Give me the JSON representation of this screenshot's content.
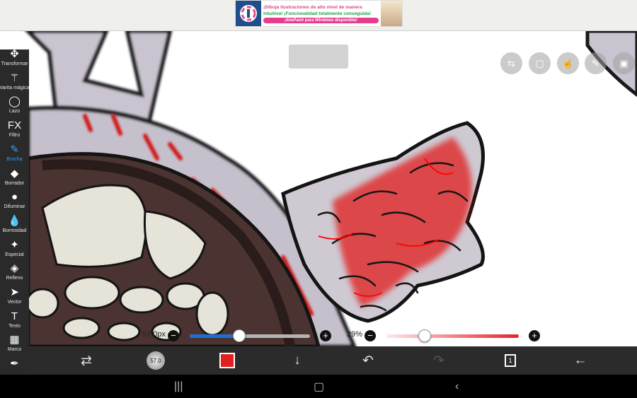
{
  "ad": {
    "line1": "¡Dibuja ilustraciones de alto nivel de manera",
    "line2": "intuitiva! ¡Funcionalidad totalmente conseguida!",
    "cta": "¡ibisPaint para Windows disponible!"
  },
  "toolbar": {
    "items": [
      {
        "label": "Transformar",
        "icon": "move-icon",
        "glyph": "✥"
      },
      {
        "label": "Varita mágica",
        "icon": "magic-wand-icon",
        "glyph": "⚚"
      },
      {
        "label": "Lazo",
        "icon": "lasso-icon",
        "glyph": "◯"
      },
      {
        "label": "Filtro",
        "icon": "fx-icon",
        "glyph": "FX"
      },
      {
        "label": "Brocha",
        "icon": "brush-icon",
        "glyph": "✎"
      },
      {
        "label": "Borrador",
        "icon": "eraser-icon",
        "glyph": "◆"
      },
      {
        "label": "Difuminar",
        "icon": "blur-icon",
        "glyph": "●"
      },
      {
        "label": "Borrosidad",
        "icon": "drop-icon",
        "glyph": "💧"
      },
      {
        "label": "Especial",
        "icon": "sparkle-icon",
        "glyph": "✦"
      },
      {
        "label": "Relleno",
        "icon": "bucket-icon",
        "glyph": "◈"
      },
      {
        "label": "Vector",
        "icon": "cursor-icon",
        "glyph": "➤"
      },
      {
        "label": "Texto",
        "icon": "text-icon",
        "glyph": "T"
      },
      {
        "label": "Marco",
        "icon": "frame-icon",
        "glyph": "▦"
      },
      {
        "label": "",
        "icon": "eyedropper-icon",
        "glyph": "✒"
      }
    ],
    "active_index": 4
  },
  "sliders": {
    "brush_size": {
      "value_text": "57.0px",
      "fraction": 0.41
    },
    "opacity": {
      "value_text": "29%",
      "fraction": 0.29
    }
  },
  "bottom_bar": {
    "brush_size_label": "57.0",
    "layer_count": "1"
  },
  "colors": {
    "accent": "#29a1ff",
    "current_color": "#e32020",
    "track_blue": "#1f6fd6",
    "opacity_red": "#e8202a"
  }
}
